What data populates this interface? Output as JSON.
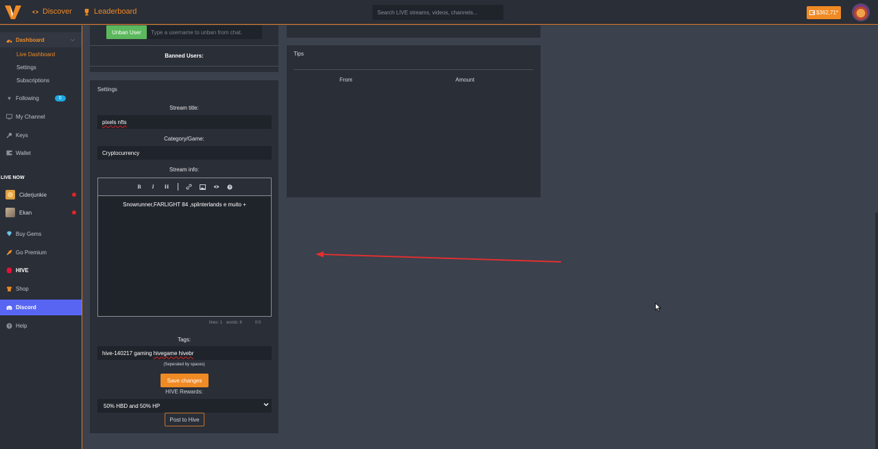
{
  "topbar": {
    "discover_label": "Discover",
    "leaderboard_label": "Leaderboard",
    "search_placeholder": "Search LIVE streams, videos, channels...",
    "wallet_balance": "$362,71*",
    "accent_color": "#f08a24"
  },
  "sidebar": {
    "dashboard": "Dashboard",
    "live_dashboard": "Live Dashboard",
    "settings": "Settings",
    "subscriptions": "Subscriptions",
    "following": "Following",
    "following_count": "0",
    "my_channel": "My Channel",
    "keys": "Keys",
    "wallet": "Wallet",
    "live_now": "LIVE NOW",
    "live_channels": [
      {
        "name": "Ciderjunkie"
      },
      {
        "name": "Ekan"
      }
    ],
    "buy_gems": "Buy Gems",
    "go_premium": "Go Premium",
    "hive": "HIVE",
    "shop": "Shop",
    "discord": "Discord",
    "help": "Help",
    "discord_color": "#5865f2"
  },
  "ban_panel": {
    "unban_button": "Unban User",
    "unban_placeholder": "Type a username to unban from chat.",
    "banned_users_label": "Banned Users:"
  },
  "settings_panel": {
    "title": "Settings",
    "stream_title_label": "Stream title:",
    "stream_title_value": "pixels nfts",
    "category_label": "Category/Game:",
    "category_value": "Cryptocurrency",
    "stream_info_label": "Stream info:",
    "stream_info_value": "Snowrunner,FARLIGHT 84 ,splinterlands e muito +",
    "editor_lines": "lines: 1",
    "editor_words": "words: 8",
    "editor_cursor": "0:0",
    "tags_label": "Tags:",
    "tags_part1": "hive-140217 gaming ",
    "tags_part2": "hivegame hivebr",
    "tags_hint": "(Seperated by spaces)",
    "save_button": "Save changes",
    "hive_rewards_label": "HIVE Rewards:",
    "hive_rewards_value": "50% HBD and 50% HP",
    "post_to_hive_button": "Post to Hive"
  },
  "tips_panel": {
    "title": "Tips",
    "col_from": "From",
    "col_amount": "Amount"
  }
}
